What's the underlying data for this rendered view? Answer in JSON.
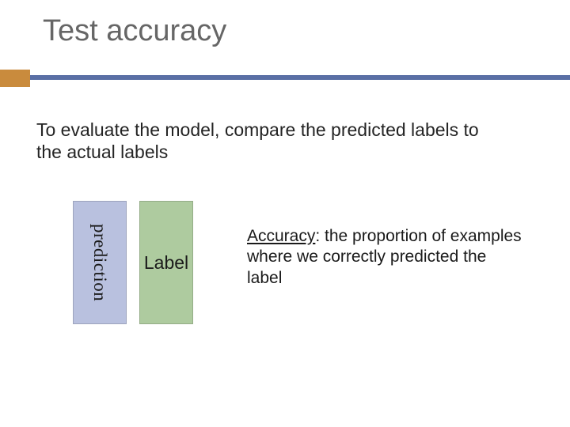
{
  "title": "Test accuracy",
  "intro": "To evaluate the model, compare the predicted labels to the actual labels",
  "boxes": {
    "prediction": "prediction",
    "label": "Label"
  },
  "definition": {
    "term": "Accuracy",
    "rest": ": the proportion of examples where we correctly predicted the label"
  }
}
